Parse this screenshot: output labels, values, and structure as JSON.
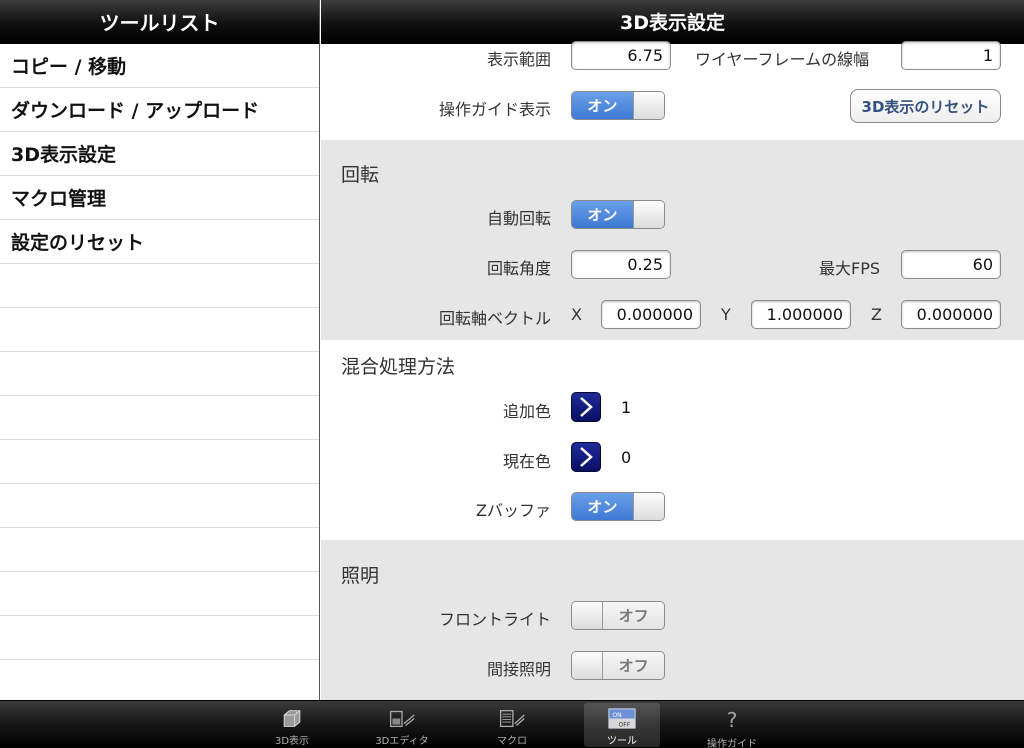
{
  "sidebar": {
    "title": "ツールリスト",
    "items": [
      {
        "label": "コピー / 移動"
      },
      {
        "label": "ダウンロード / アップロード"
      },
      {
        "label": "3D表示設定"
      },
      {
        "label": "マクロ管理"
      },
      {
        "label": "設定のリセット"
      }
    ],
    "empty_rows": 10
  },
  "main": {
    "title": "3D表示設定",
    "display": {
      "range_label": "表示範囲",
      "range_value": "6.75",
      "wire_width_label": "ワイヤーフレームの線幅",
      "wire_width_value": "1",
      "guide_label": "操作ガイド表示",
      "guide_toggle": "オン",
      "reset_button": "3D表示のリセット"
    },
    "rotation": {
      "title": "回転",
      "auto_label": "自動回転",
      "auto_toggle": "オン",
      "angle_label": "回転角度",
      "angle_value": "0.25",
      "maxfps_label": "最大FPS",
      "maxfps_value": "60",
      "axis_label": "回転軸ベクトル",
      "x_label": "X",
      "x_value": "0.000000",
      "y_label": "Y",
      "y_value": "1.000000",
      "z_label": "Z",
      "z_value": "0.000000"
    },
    "blend": {
      "title": "混合処理方法",
      "add_label": "追加色",
      "add_value": "1",
      "current_label": "現在色",
      "current_value": "0",
      "zbuffer_label": "Zバッファ",
      "zbuffer_toggle": "オン"
    },
    "lighting": {
      "title": "照明",
      "front_label": "フロントライト",
      "front_toggle": "オフ",
      "indirect_label": "間接照明",
      "indirect_toggle": "オフ"
    }
  },
  "tabbar": {
    "tabs": [
      {
        "label": "3D表示",
        "icon": "cube-icon"
      },
      {
        "label": "3Dエディタ",
        "icon": "editor-icon"
      },
      {
        "label": "マクロ",
        "icon": "macro-icon"
      },
      {
        "label": "ツール",
        "icon": "onoff-icon",
        "selected": true
      },
      {
        "label": "操作ガイド",
        "icon": "question-icon"
      }
    ],
    "icon_glyphs": {
      "question": "?",
      "on": "ON",
      "off": "OFF"
    }
  },
  "colors": {
    "toggle_on": "#3d78d5",
    "section_gray": "#e6e6e6",
    "chevron_navy": "#0a0f63",
    "reset_text": "#33507e"
  }
}
